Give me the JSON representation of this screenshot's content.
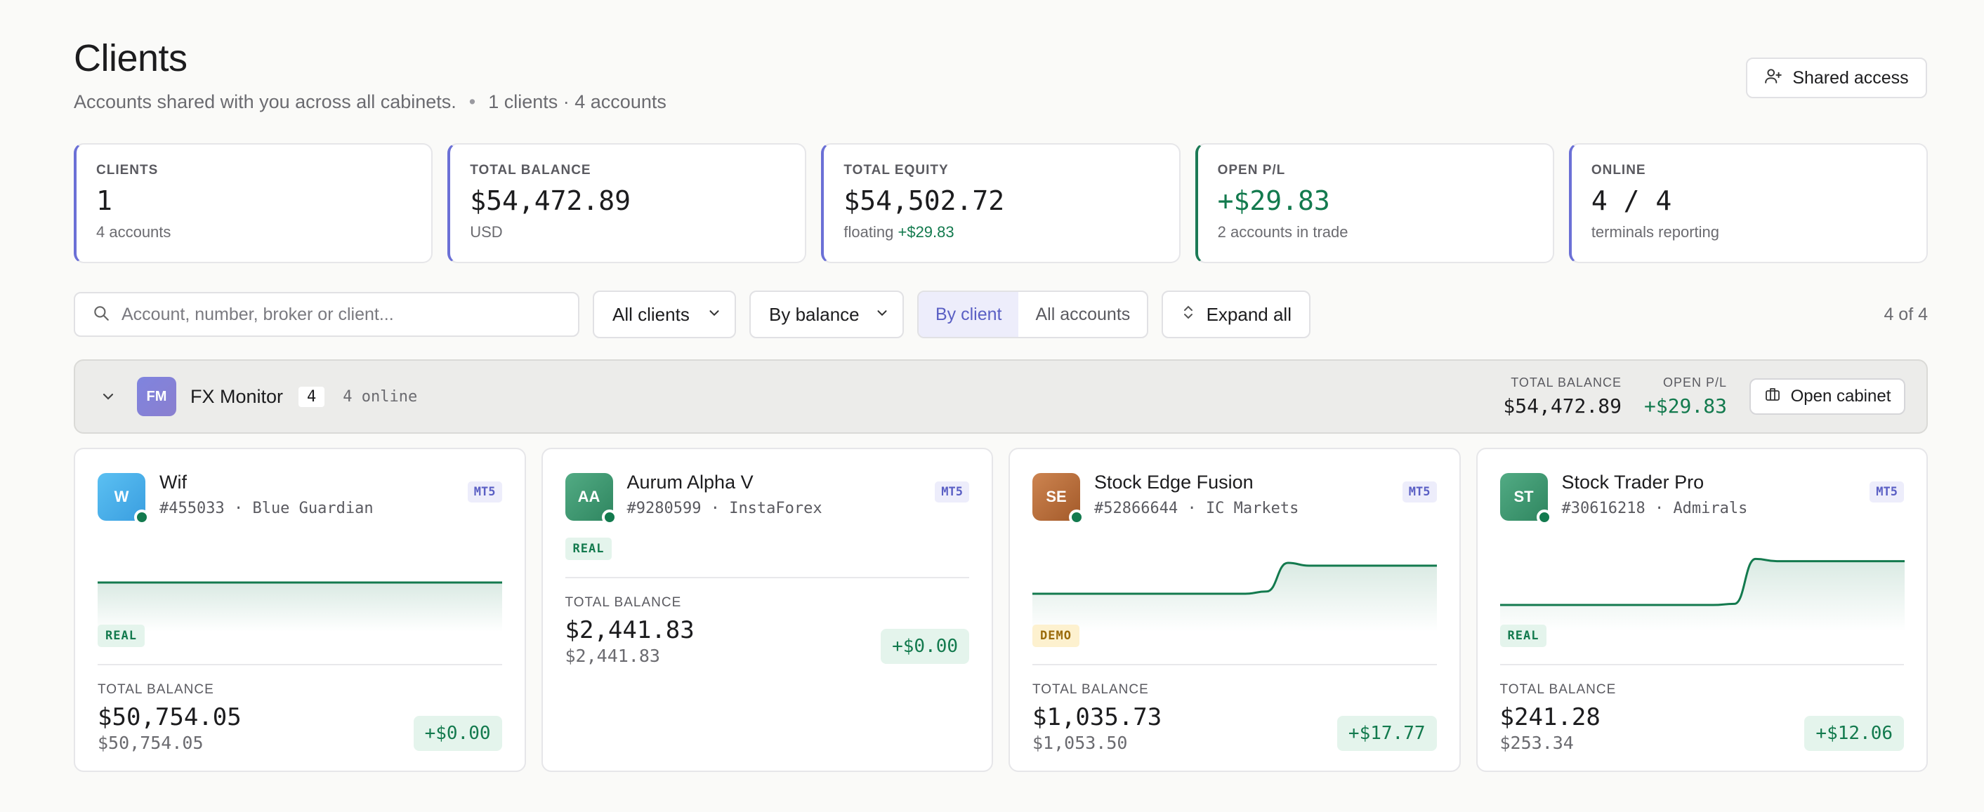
{
  "header": {
    "title": "Clients",
    "subtitle": "Accounts shared with you across all cabinets.",
    "summary": "1 clients · 4 accounts",
    "shared_access_label": "Shared access"
  },
  "stats": [
    {
      "label": "CLIENTS",
      "value": "1",
      "sub": "4 accounts"
    },
    {
      "label": "TOTAL BALANCE",
      "value": "$54,472.89",
      "sub": "USD"
    },
    {
      "label": "TOTAL EQUITY",
      "value": "$54,502.72",
      "sub_prefix": "floating",
      "sub_highlight": "+$29.83"
    },
    {
      "label": "OPEN P/L",
      "value": "+$29.83",
      "sub": "2 accounts in trade"
    },
    {
      "label": "ONLINE",
      "value": "4 / 4",
      "sub": "terminals reporting"
    }
  ],
  "toolbar": {
    "search_placeholder": "Account, number, broker or client...",
    "client_filter": "All clients",
    "sort": "By balance",
    "view_by_client": "By client",
    "view_all_accounts": "All accounts",
    "expand_all": "Expand all",
    "count": "4 of 4"
  },
  "group": {
    "initials": "FM",
    "name": "FX Monitor",
    "count": "4",
    "online": "4 online",
    "total_balance_label": "TOTAL BALANCE",
    "total_balance": "$54,472.89",
    "open_pl_label": "OPEN P/L",
    "open_pl": "+$29.83",
    "open_cabinet_label": "Open cabinet"
  },
  "accounts": [
    {
      "initials": "W",
      "name": "Wif",
      "meta": "#455033 · Blue Guardian",
      "platform": "MT5",
      "type": "REAL",
      "balance_label": "TOTAL BALANCE",
      "balance": "$50,754.05",
      "equity": "$50,754.05",
      "pl": "+$0.00",
      "spark": [
        0.5,
        0.5,
        0.5,
        0.5,
        0.5,
        0.5,
        0.5,
        0.5
      ]
    },
    {
      "initials": "AA",
      "name": "Aurum Alpha V",
      "meta": "#9280599 · InstaForex",
      "platform": "MT5",
      "type": "REAL",
      "balance_label": "TOTAL BALANCE",
      "balance": "$2,441.83",
      "equity": "$2,441.83",
      "pl": "+$0.00",
      "spark": []
    },
    {
      "initials": "SE",
      "name": "Stock Edge Fusion",
      "meta": "#52866644 · IC Markets",
      "platform": "MT5",
      "type": "DEMO",
      "balance_label": "TOTAL BALANCE",
      "balance": "$1,035.73",
      "equity": "$1,053.50",
      "pl": "+$17.77",
      "spark": [
        0.3,
        0.3,
        0.3,
        0.3,
        0.3,
        0.3,
        0.3,
        0.3,
        0.3,
        0.3,
        0.3,
        0.34,
        0.85,
        0.8,
        0.8,
        0.8,
        0.8,
        0.8,
        0.8,
        0.8
      ]
    },
    {
      "initials": "ST",
      "name": "Stock Trader Pro",
      "meta": "#30616218 · Admirals",
      "platform": "MT5",
      "type": "REAL",
      "balance_label": "TOTAL BALANCE",
      "balance": "$241.28",
      "equity": "$253.34",
      "pl": "+$12.06",
      "spark": [
        0.1,
        0.1,
        0.1,
        0.1,
        0.1,
        0.1,
        0.1,
        0.1,
        0.1,
        0.1,
        0.1,
        0.12,
        0.92,
        0.88,
        0.88,
        0.88,
        0.88,
        0.88,
        0.88,
        0.88
      ]
    }
  ],
  "colors": {
    "accent": "#6b70d6",
    "positive": "#137a4e",
    "avatar_gradients": [
      [
        "#52b8ee",
        "#3a9ee0"
      ],
      [
        "#4fa67f",
        "#2f8660"
      ],
      [
        "#c57a45",
        "#a35a2a"
      ],
      [
        "#4fa67f",
        "#2f8660"
      ]
    ]
  }
}
